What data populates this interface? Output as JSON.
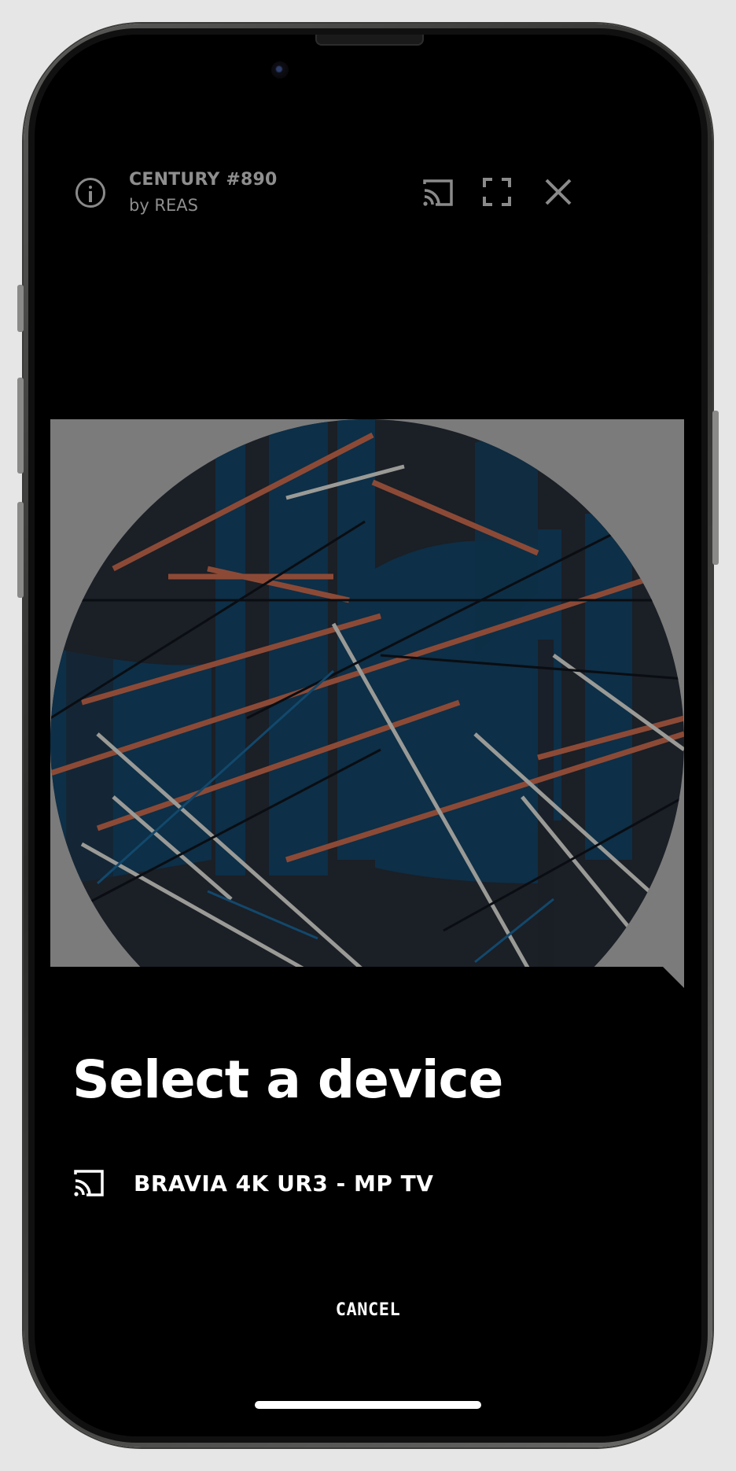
{
  "artwork_info": {
    "title": "CENTURY #890",
    "author": "by REAS"
  },
  "top_actions": [
    "info-icon",
    "cast-icon",
    "fullscreen-icon",
    "close-icon"
  ],
  "device_picker": {
    "title": "Select a device",
    "devices": [
      {
        "name": "BRAVIA 4K UR3 - MP TV",
        "icon": "cast-icon"
      }
    ],
    "cancel_label": "CANCEL"
  },
  "colors": {
    "background": "#000000",
    "artwork_bg": "#7b7b7b",
    "art_dark": "#1b1f26",
    "art_blue": "#0d2f47",
    "art_orange": "#8c4a36",
    "art_gray_line": "#9a9a96",
    "icon_gray": "#8a8a8a"
  }
}
